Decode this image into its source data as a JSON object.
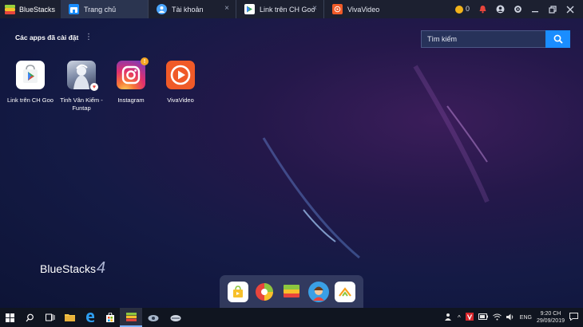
{
  "titlebar": {
    "brand": "BlueStacks",
    "tabs": [
      {
        "label": "Trang chủ",
        "icon": "home-icon",
        "active": true
      },
      {
        "label": "Tài khoản",
        "icon": "account-icon",
        "active": false
      },
      {
        "label": "Link trên CH Goo",
        "icon": "play-store-icon",
        "active": false
      },
      {
        "label": "VivaVideo",
        "icon": "vivavideo-icon",
        "active": false
      }
    ],
    "coins": "0"
  },
  "home": {
    "section_title": "Các apps đã cài đặt",
    "search_placeholder": "Tìm kiếm",
    "apps": [
      {
        "label": "Link trên CH Goo",
        "icon": "play-store-icon"
      },
      {
        "label": "Tinh Vân Kiếm - Funtap",
        "icon": "tinh-van-kiem-icon"
      },
      {
        "label": "Instagram",
        "icon": "instagram-icon",
        "badge": "!"
      },
      {
        "label": "VivaVideo",
        "icon": "vivavideo-icon"
      }
    ],
    "watermark": "BlueStacks",
    "watermark_version": "4"
  },
  "dock": [
    "app-center-icon",
    "game-icon",
    "bluestacks-layers-icon",
    "avatar-game-icon",
    "camp-icon"
  ],
  "taskbar": {
    "lang": "ENG",
    "time": "9:20 CH",
    "date": "29/09/2019"
  },
  "colors": {
    "accent": "#1a8dff",
    "titlebar": "#1c2030",
    "active_tab": "#2b3550"
  }
}
